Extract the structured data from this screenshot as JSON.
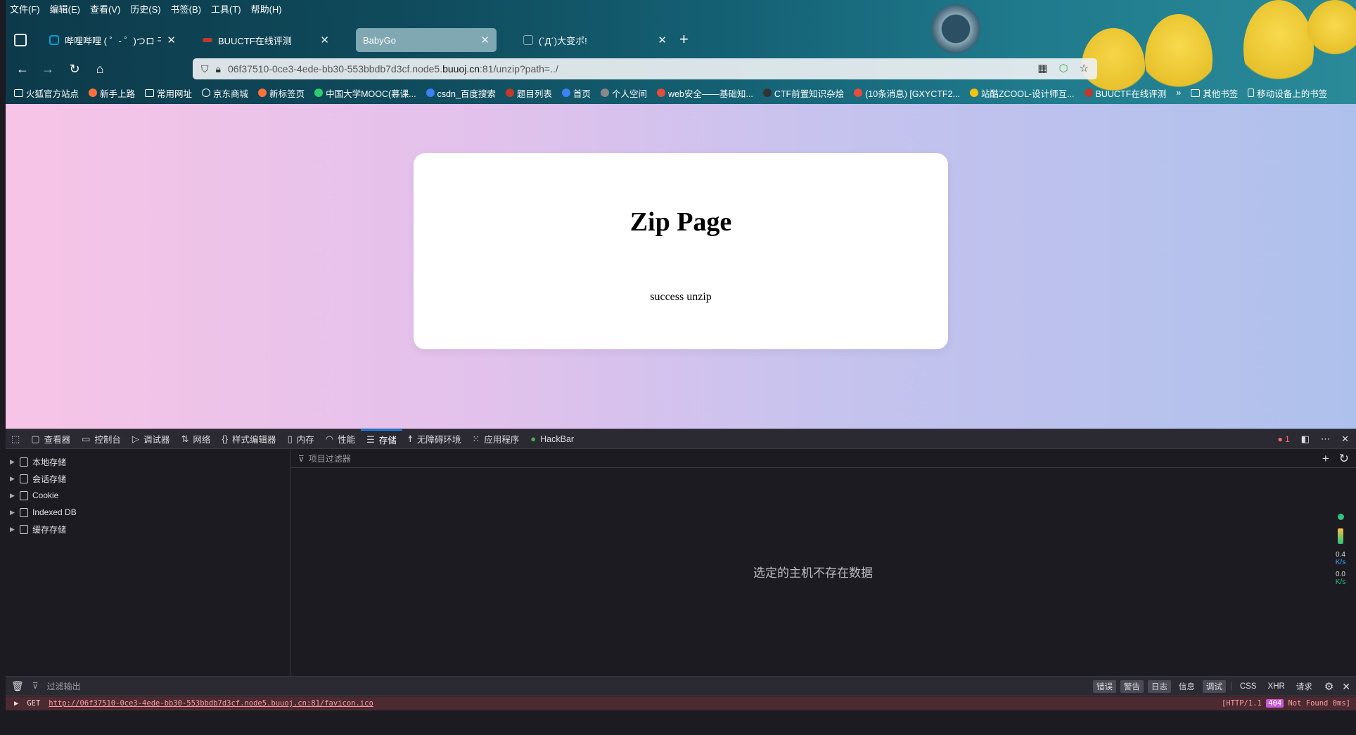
{
  "menubar": [
    "文件(F)",
    "编辑(E)",
    "查看(V)",
    "历史(S)",
    "书签(B)",
    "工具(T)",
    "帮助(H)"
  ],
  "tabs": [
    {
      "label": "哔哩哔哩 ( ゜- ゜)つロ 干杯~-bili",
      "icon_color": "#00a1d6"
    },
    {
      "label": "BUUCTF在线评测",
      "icon_color": "#c0392b"
    },
    {
      "label": "BabyGo",
      "icon_color": "#7fa8b2"
    },
    {
      "label": "(`Д´)大变ポ!",
      "icon_color": "#9aa7ab"
    }
  ],
  "url": {
    "prefix": "06f37510-0ce3-4ede-bb30-553bbdb7d3cf.node5.",
    "host": "buuoj.cn",
    "suffix": ":81/unzip?path=../"
  },
  "bookmarks": [
    {
      "label": "火狐官方站点",
      "kind": "folder"
    },
    {
      "label": "新手上路",
      "kind": "firefox",
      "color": "#ff7139"
    },
    {
      "label": "常用网址",
      "kind": "folder"
    },
    {
      "label": "京东商城",
      "kind": "globe",
      "color": "#ffffff"
    },
    {
      "label": "新标签页",
      "kind": "firefox",
      "color": "#ff7139"
    },
    {
      "label": "中国大学MOOC(慕课...",
      "kind": "site",
      "color": "#2ecc71"
    },
    {
      "label": "csdn_百度搜索",
      "kind": "site",
      "color": "#3b82f6"
    },
    {
      "label": "题目列表",
      "kind": "site",
      "color": "#c0392b"
    },
    {
      "label": "首页",
      "kind": "site",
      "color": "#3b82f6"
    },
    {
      "label": "个人空间",
      "kind": "site",
      "color": "#888888"
    },
    {
      "label": "web安全——基础知...",
      "kind": "site",
      "color": "#e74c3c"
    },
    {
      "label": "CTF前置知识杂烩",
      "kind": "site",
      "color": "#333333"
    },
    {
      "label": "(10条消息) [GXYCTF2...",
      "kind": "site",
      "color": "#e74c3c"
    },
    {
      "label": "站酷ZCOOL-设计师互...",
      "kind": "site",
      "color": "#f1c40f"
    },
    {
      "label": "BUUCTF在线评测",
      "kind": "site",
      "color": "#c0392b"
    },
    {
      "label": "其他书签",
      "kind": "folder"
    },
    {
      "label": "移动设备上的书签",
      "kind": "folder"
    }
  ],
  "page": {
    "title": "Zip Page",
    "message": "success unzip"
  },
  "devtools": {
    "tabs": [
      {
        "label": "查看器",
        "icon": "inspector-icon"
      },
      {
        "label": "控制台",
        "icon": "console-icon"
      },
      {
        "label": "调试器",
        "icon": "debugger-icon"
      },
      {
        "label": "网络",
        "icon": "network-icon"
      },
      {
        "label": "样式编辑器",
        "icon": "style-editor-icon"
      },
      {
        "label": "内存",
        "icon": "memory-icon"
      },
      {
        "label": "性能",
        "icon": "performance-icon"
      },
      {
        "label": "存储",
        "icon": "storage-icon"
      },
      {
        "label": "无障碍环境",
        "icon": "accessibility-icon"
      },
      {
        "label": "应用程序",
        "icon": "application-icon"
      },
      {
        "label": "HackBar",
        "icon": "hackbar-icon"
      }
    ],
    "active_tab": "存储",
    "error_count": "1",
    "storage_tree": [
      "本地存储",
      "会话存储",
      "Cookie",
      "Indexed DB",
      "缓存存储"
    ],
    "filter_placeholder": "项目过滤器",
    "empty_message": "选定的主机不存在数据",
    "net_up": "0.4",
    "net_up_unit": "K/s",
    "net_down": "0.0",
    "net_down_unit": "K/s",
    "console": {
      "filter_placeholder": "过滤输出",
      "filters": [
        "错误",
        "警告",
        "日志",
        "信息",
        "调试",
        "CSS",
        "XHR",
        "请求"
      ],
      "active_filters": [
        "错误",
        "警告",
        "日志",
        "调试"
      ],
      "line_method": "GET",
      "line_url": "http://06f37510-0ce3-4ede-bb30-553bbdb7d3cf.node5.buuoj.cn:81/favicon.ico",
      "line_proto": "[HTTP/1.1",
      "line_status": "404",
      "line_status_text": "Not Found 0ms]"
    }
  }
}
